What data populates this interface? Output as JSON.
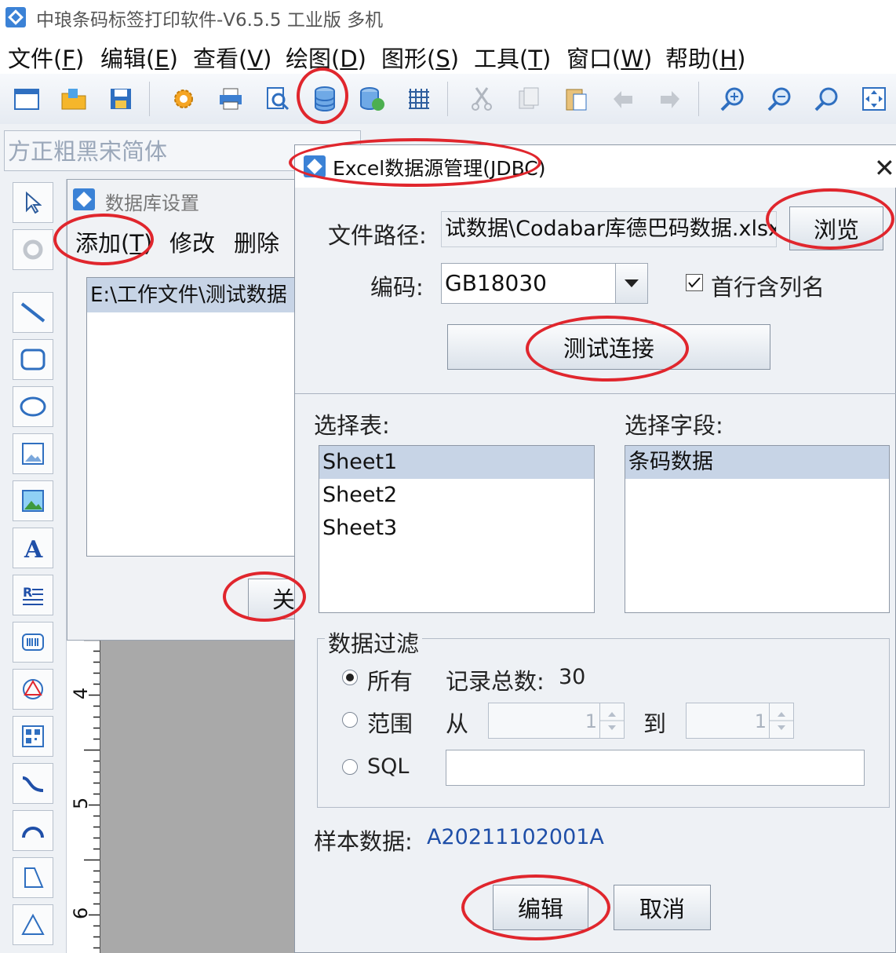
{
  "app": {
    "title": "中琅条码标签打印软件-V6.5.5 工业版 多机"
  },
  "menu": [
    {
      "label": "文件(",
      "key": "F",
      "end": ")"
    },
    {
      "label": "编辑(",
      "key": "E",
      "end": ")"
    },
    {
      "label": "查看(",
      "key": "V",
      "end": ")"
    },
    {
      "label": "绘图(",
      "key": "D",
      "end": ")"
    },
    {
      "label": "图形(",
      "key": "S",
      "end": ")"
    },
    {
      "label": "工具(",
      "key": "T",
      "end": ")"
    },
    {
      "label": "窗口(",
      "key": "W",
      "end": ")"
    },
    {
      "label": "帮助(",
      "key": "H",
      "end": ")"
    }
  ],
  "fontbar": {
    "font": "方正粗黑宋简体"
  },
  "db_dialog": {
    "title": "数据库设置",
    "add_label": "添加(",
    "add_key": "T",
    "add_end": ")",
    "modify_label": "修改",
    "delete_label": "删除",
    "list_item": "E:\\工作文件\\测试数据",
    "close_label": "关"
  },
  "ruler": {
    "marks": [
      "4",
      "5",
      "6"
    ]
  },
  "excel_dialog": {
    "title": "Excel数据源管理(JDBC)",
    "close_glyph": "✕",
    "path_label": "文件路径:",
    "path_value": "试数据\\Codabar库德巴码数据.xlsx",
    "browse_label": "浏览",
    "encoding_label": "编码:",
    "encoding_value": "GB18030",
    "header_checkbox_label": "首行含列名",
    "header_checked": true,
    "test_label": "测试连接",
    "select_table_label": "选择表:",
    "tables": [
      "Sheet1",
      "Sheet2",
      "Sheet3"
    ],
    "select_field_label": "选择字段:",
    "fields": [
      "条码数据"
    ],
    "filter_label": "数据过滤",
    "all_label": "所有",
    "total_label": "记录总数:",
    "total_value": "30",
    "range_label": "范围",
    "from_label": "从",
    "from_value": "1",
    "to_label": "到",
    "to_value": "1",
    "sql_label": "SQL",
    "sql_value": "",
    "sample_label": "样本数据:",
    "sample_value": "A20211102001A",
    "edit_label": "编辑",
    "cancel_label": "取消"
  },
  "colors": {
    "highlight_ring": "#e0262d",
    "sample_text": "#1f4fa8"
  }
}
